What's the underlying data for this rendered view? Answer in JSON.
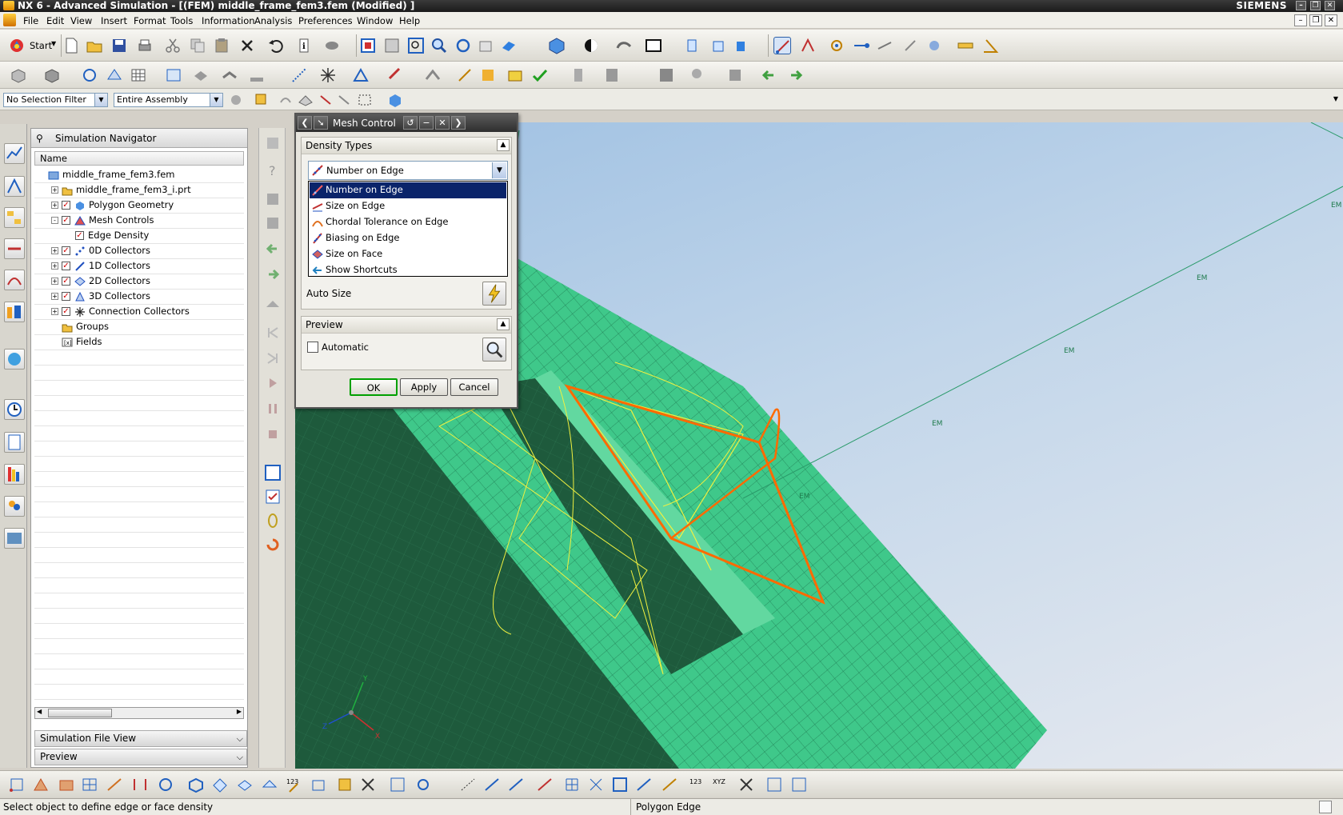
{
  "window": {
    "title": "NX 6 - Advanced Simulation - [(FEM) middle_frame_fem3.fem (Modified) ]",
    "brand": "SIEMENS"
  },
  "menu": [
    "File",
    "Edit",
    "View",
    "Insert",
    "Format",
    "Tools",
    "Information",
    "Analysis",
    "Preferences",
    "Window",
    "Help"
  ],
  "toolbar": {
    "start_label": "Start"
  },
  "selection": {
    "filter": "No Selection Filter",
    "scope": "Entire Assembly"
  },
  "navigator": {
    "title": "Simulation Navigator",
    "column_name": "Name",
    "tree": [
      {
        "label": "middle_frame_fem3.fem",
        "level": 0,
        "expander": "",
        "checked": null,
        "icon": "fem-icon"
      },
      {
        "label": "middle_frame_fem3_i.prt",
        "level": 1,
        "expander": "+",
        "checked": null,
        "icon": "folder-icon"
      },
      {
        "label": "Polygon Geometry",
        "level": 1,
        "expander": "+",
        "checked": true,
        "icon": "polygon-geometry-icon"
      },
      {
        "label": "Mesh Controls",
        "level": 1,
        "expander": "-",
        "checked": true,
        "icon": "mesh-controls-icon"
      },
      {
        "label": "Edge Density",
        "level": 2,
        "expander": "",
        "checked": true,
        "icon": ""
      },
      {
        "label": "0D Collectors",
        "level": 1,
        "expander": "+",
        "checked": true,
        "icon": "0d-collector-icon"
      },
      {
        "label": "1D Collectors",
        "level": 1,
        "expander": "+",
        "checked": true,
        "icon": "1d-collector-icon"
      },
      {
        "label": "2D Collectors",
        "level": 1,
        "expander": "+",
        "checked": true,
        "icon": "2d-collector-icon"
      },
      {
        "label": "3D Collectors",
        "level": 1,
        "expander": "+",
        "checked": true,
        "icon": "3d-collector-icon"
      },
      {
        "label": "Connection Collectors",
        "level": 1,
        "expander": "+",
        "checked": true,
        "icon": "connection-collector-icon"
      },
      {
        "label": "Groups",
        "level": 1,
        "expander": "",
        "checked": null,
        "icon": "folder-icon"
      },
      {
        "label": "Fields",
        "level": 1,
        "expander": "",
        "checked": null,
        "icon": "fields-icon"
      }
    ],
    "sim_file_view": "Simulation File View",
    "preview": "Preview"
  },
  "dialog": {
    "title": "Mesh Control",
    "density_types_header": "Density Types",
    "selected_type": "Number on Edge",
    "options": [
      "Number on Edge",
      "Size on Edge",
      "Chordal Tolerance on Edge",
      "Biasing on Edge",
      "Size on Face",
      "Show Shortcuts"
    ],
    "auto_size_label": "Auto Size",
    "preview_header": "Preview",
    "automatic_label": "Automatic",
    "ok": "OK",
    "apply": "Apply",
    "cancel": "Cancel"
  },
  "viewport": {
    "edge_label": "EM",
    "triad_axes": [
      "X",
      "Y",
      "Z"
    ],
    "colors": {
      "mesh_light": "#3fc88a",
      "mesh_dark": "#1e5a3c",
      "highlight_orange": "#ff6a00",
      "highlight_yellow": "#f0f040",
      "background_top": "#9ec0e2",
      "background_bottom": "#e6e9ef"
    }
  },
  "status": {
    "prompt": "Select object to define edge or face density",
    "selection_type": "Polygon Edge"
  }
}
